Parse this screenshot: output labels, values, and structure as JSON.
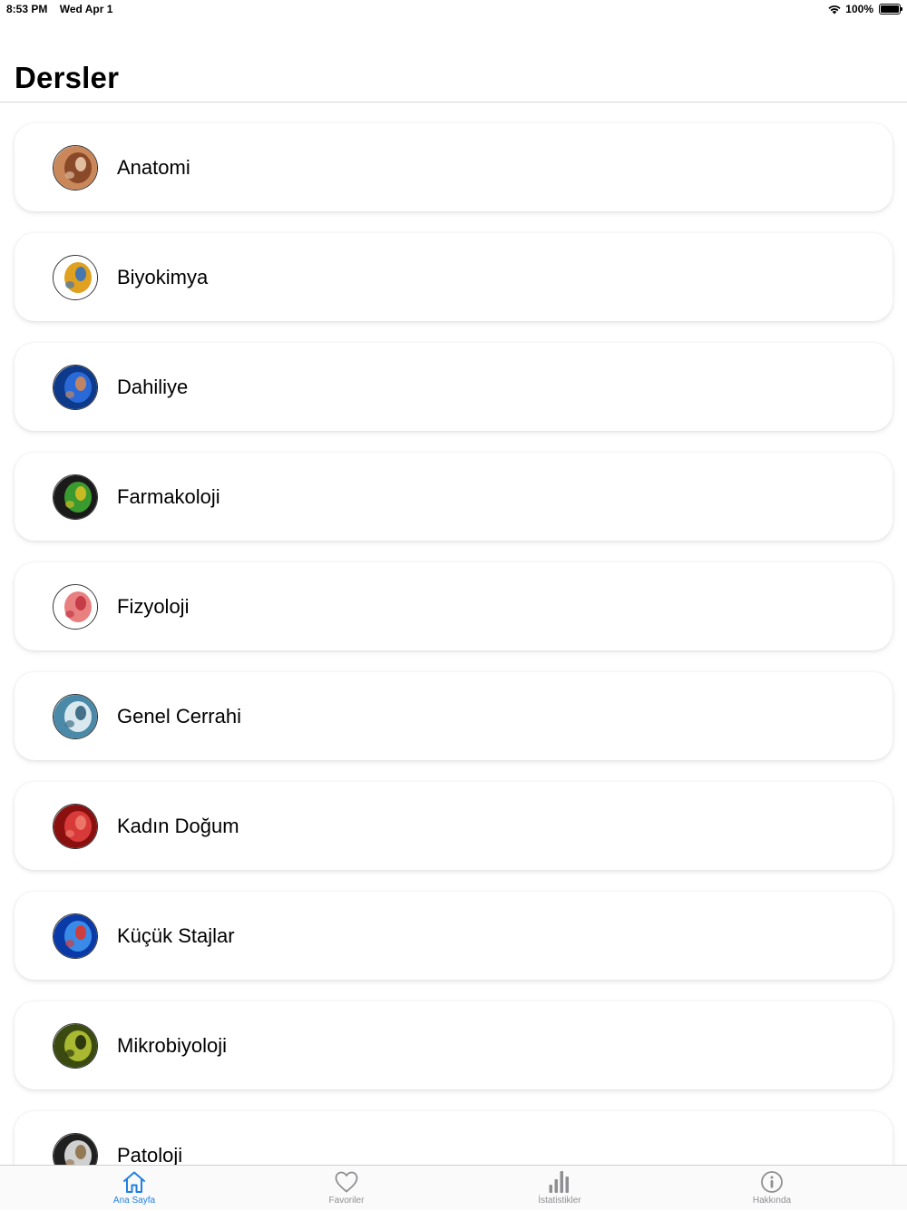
{
  "status_bar": {
    "time": "8:53 PM",
    "date": "Wed Apr 1",
    "battery": "100%",
    "battery_level": 1.0,
    "wifi_icon": "wifi-icon"
  },
  "header": {
    "title": "Dersler"
  },
  "courses": [
    {
      "label": "Anatomi",
      "icon": "anatomy-head-icon",
      "colors": [
        "#c9875a",
        "#8a4a2a",
        "#f1d1b5"
      ]
    },
    {
      "label": "Biyokimya",
      "icon": "dna-helix-icon",
      "colors": [
        "#ffffff",
        "#e0a020",
        "#2a70c8"
      ]
    },
    {
      "label": "Dahiliye",
      "icon": "internal-organs-icon",
      "colors": [
        "#0d3a8a",
        "#2a6ad8",
        "#d88a50"
      ]
    },
    {
      "label": "Farmakoloji",
      "icon": "pills-icon",
      "colors": [
        "#1a1a1a",
        "#3a9a30",
        "#e0c020"
      ]
    },
    {
      "label": "Fizyoloji",
      "icon": "heart-anatomy-icon",
      "colors": [
        "#ffffff",
        "#e88080",
        "#c03040"
      ]
    },
    {
      "label": "Genel Cerrahi",
      "icon": "surgery-team-icon",
      "colors": [
        "#4a8aa8",
        "#d8e8ee",
        "#2a5a78"
      ]
    },
    {
      "label": "Kadın Doğum",
      "icon": "fetus-icon",
      "colors": [
        "#8a1010",
        "#d83a3a",
        "#f08070"
      ]
    },
    {
      "label": "Küçük Stajlar",
      "icon": "spine-xray-icon",
      "colors": [
        "#0a3aa8",
        "#3a8ae8",
        "#e83020"
      ]
    },
    {
      "label": "Mikrobiyoloji",
      "icon": "bacteria-icon",
      "colors": [
        "#3a4a10",
        "#a8b830",
        "#1a2208"
      ]
    },
    {
      "label": "Patoloji",
      "icon": "microscope-icon",
      "colors": [
        "#202020",
        "#d0d0d0",
        "#8a6a40"
      ]
    }
  ],
  "tab_bar": {
    "accent_color": "#1f7fe5",
    "inactive_color": "#8e8e93",
    "tabs": [
      {
        "label": "Ana Sayfa",
        "icon": "home-icon",
        "active": true
      },
      {
        "label": "Favoriler",
        "icon": "heart-icon",
        "active": false
      },
      {
        "label": "İstatistikler",
        "icon": "bar-chart-icon",
        "active": false
      },
      {
        "label": "Hakkında",
        "icon": "info-icon",
        "active": false
      }
    ]
  }
}
